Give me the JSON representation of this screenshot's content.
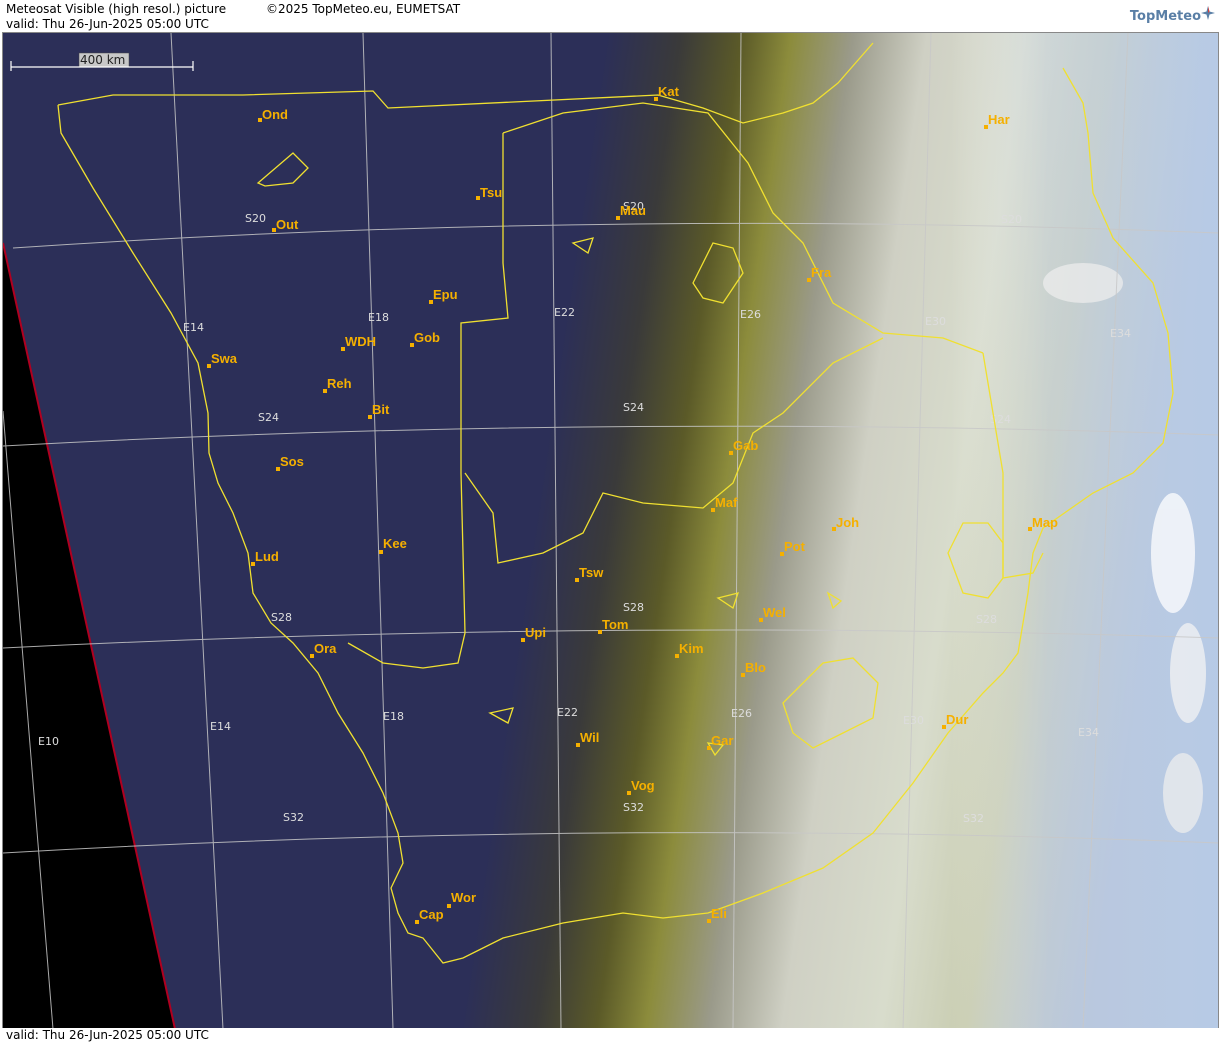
{
  "header": {
    "title": "Meteosat Visible (high resol.) picture",
    "copyright": "©2025 TopMeteo.eu, EUMETSAT",
    "valid": "valid:  Thu  26-Jun-2025  05:00 UTC",
    "logo": "TopMeteo"
  },
  "footer": {
    "valid": "valid:  Thu  26-Jun-2025  05:00 UTC"
  },
  "scale": {
    "label": "400 km"
  },
  "colors": {
    "land_night": "#2c2f58",
    "border": "#f0e030",
    "city": "#f5b000",
    "grid": "#c8c8c8",
    "space": "#000000",
    "limb": "#b00020"
  },
  "grid_labels": {
    "lat": [
      "S20",
      "S24",
      "S28",
      "S32",
      "S20",
      "S24",
      "S28",
      "S32",
      "S20",
      "S24",
      "S28",
      "S32",
      "S20",
      "S24",
      "S28",
      "S32"
    ],
    "lon": [
      "E10",
      "E14",
      "E14",
      "E18",
      "E18",
      "E22",
      "E22",
      "E26",
      "E26",
      "E30",
      "E30",
      "E34",
      "E34"
    ]
  },
  "cities": [
    {
      "name": "Ond"
    },
    {
      "name": "Out"
    },
    {
      "name": "Tsu"
    },
    {
      "name": "Kat"
    },
    {
      "name": "Mau"
    },
    {
      "name": "Har"
    },
    {
      "name": "Epu"
    },
    {
      "name": "Swa"
    },
    {
      "name": "WDH"
    },
    {
      "name": "Gob"
    },
    {
      "name": "Fra"
    },
    {
      "name": "Reh"
    },
    {
      "name": "Bit"
    },
    {
      "name": "Sos"
    },
    {
      "name": "Gab"
    },
    {
      "name": "Maf"
    },
    {
      "name": "Joh"
    },
    {
      "name": "Map"
    },
    {
      "name": "Lud"
    },
    {
      "name": "Kee"
    },
    {
      "name": "Pot"
    },
    {
      "name": "Tsw"
    },
    {
      "name": "Wel"
    },
    {
      "name": "Upi"
    },
    {
      "name": "Tom"
    },
    {
      "name": "Kim"
    },
    {
      "name": "Ora"
    },
    {
      "name": "Blo"
    },
    {
      "name": "Dur"
    },
    {
      "name": "Wil"
    },
    {
      "name": "Gar"
    },
    {
      "name": "Vog"
    },
    {
      "name": "Wor"
    },
    {
      "name": "Cap"
    },
    {
      "name": "Eli"
    }
  ]
}
